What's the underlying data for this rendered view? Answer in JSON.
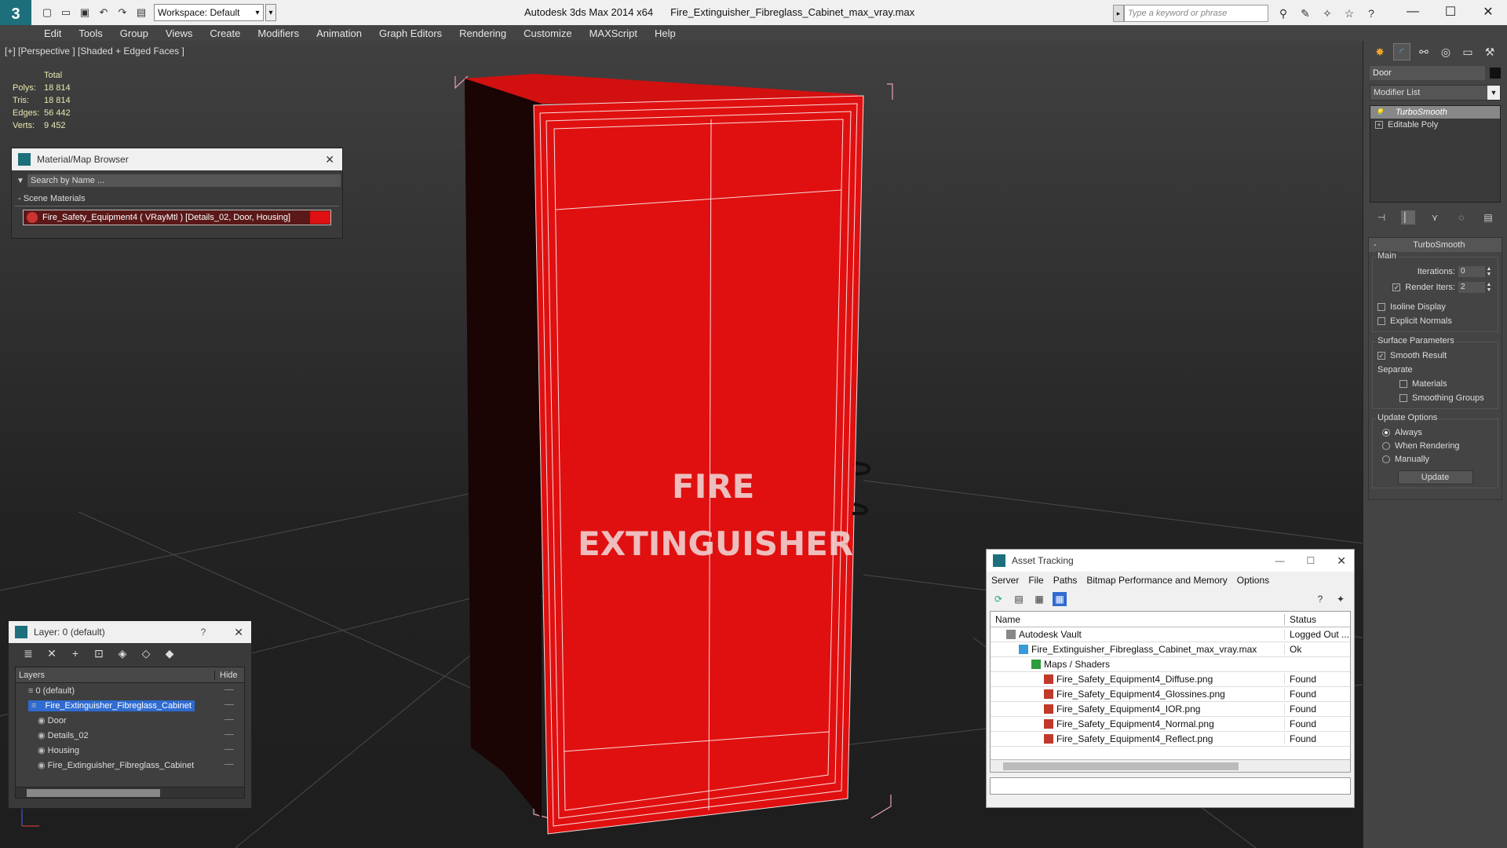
{
  "app": {
    "title": "Autodesk 3ds Max  2014 x64",
    "file": "Fire_Extinguisher_Fibreglass_Cabinet_max_vray.max",
    "workspace": "Workspace: Default",
    "search_placeholder": "Type a keyword or phrase"
  },
  "menu": [
    "Edit",
    "Tools",
    "Group",
    "Views",
    "Create",
    "Modifiers",
    "Animation",
    "Graph Editors",
    "Rendering",
    "Customize",
    "MAXScript",
    "Help"
  ],
  "viewport": {
    "label": "[+] [Perspective ] [Shaded + Edged Faces ]",
    "stats": {
      "header": "Total",
      "rows": [
        {
          "k": "Polys:",
          "v": "18 814"
        },
        {
          "k": "Tris:",
          "v": "18 814"
        },
        {
          "k": "Edges:",
          "v": "56 442"
        },
        {
          "k": "Verts:",
          "v": "9 452"
        }
      ]
    },
    "cabinet_text_line1": "FIRE",
    "cabinet_text_line2": "EXTINGUISHER",
    "colors": {
      "cabinet": "#e01010",
      "wire": "#ffffff",
      "bbox": "#e8a0b0"
    }
  },
  "material_browser": {
    "title": "Material/Map Browser",
    "search": "Search by Name ...",
    "section": "- Scene Materials",
    "item": "Fire_Safety_Equipment4  ( VRayMtl ) [Details_02, Door, Housing]"
  },
  "layers": {
    "title": "Layer: 0 (default)",
    "help": "?",
    "col_name": "Layers",
    "col_hide": "Hide",
    "rows": [
      {
        "name": "0 (default)",
        "indent": 1
      },
      {
        "name": "Fire_Extinguisher_Fibreglass_Cabinet",
        "indent": 1,
        "selected": true
      },
      {
        "name": "Door",
        "indent": 2
      },
      {
        "name": "Details_02",
        "indent": 2
      },
      {
        "name": "Housing",
        "indent": 2
      },
      {
        "name": "Fire_Extinguisher_Fibreglass_Cabinet",
        "indent": 2
      }
    ]
  },
  "assets": {
    "title": "Asset Tracking",
    "menu": [
      "Server",
      "File",
      "Paths",
      "Bitmap Performance and Memory",
      "Options"
    ],
    "col_name": "Name",
    "col_status": "Status",
    "rows": [
      {
        "name": "Autodesk Vault",
        "status": "Logged Out ...",
        "indent": 1
      },
      {
        "name": "Fire_Extinguisher_Fibreglass_Cabinet_max_vray.max",
        "status": "Ok",
        "indent": 2
      },
      {
        "name": "Maps / Shaders",
        "status": "",
        "indent": 3
      },
      {
        "name": "Fire_Safety_Equipment4_Diffuse.png",
        "status": "Found",
        "indent": 4
      },
      {
        "name": "Fire_Safety_Equipment4_Glossines.png",
        "status": "Found",
        "indent": 4
      },
      {
        "name": "Fire_Safety_Equipment4_IOR.png",
        "status": "Found",
        "indent": 4
      },
      {
        "name": "Fire_Safety_Equipment4_Normal.png",
        "status": "Found",
        "indent": 4
      },
      {
        "name": "Fire_Safety_Equipment4_Reflect.png",
        "status": "Found",
        "indent": 4
      }
    ]
  },
  "command_panel": {
    "object_name": "Door",
    "modifier_list": "Modifier List",
    "stack": [
      "TurboSmooth",
      "Editable Poly"
    ],
    "rollout_title": "TurboSmooth",
    "main_label": "Main",
    "iterations_label": "Iterations:",
    "iterations": "0",
    "render_iters_label": "Render Iters:",
    "render_iters": "2",
    "isoline": "Isoline Display",
    "explicit_normals": "Explicit Normals",
    "surface_label": "Surface Parameters",
    "smooth_result": "Smooth Result",
    "separate_label": "Separate",
    "materials": "Materials",
    "smoothing_groups": "Smoothing Groups",
    "update_label": "Update Options",
    "always": "Always",
    "when_rendering": "When Rendering",
    "manually": "Manually",
    "update_btn": "Update"
  }
}
